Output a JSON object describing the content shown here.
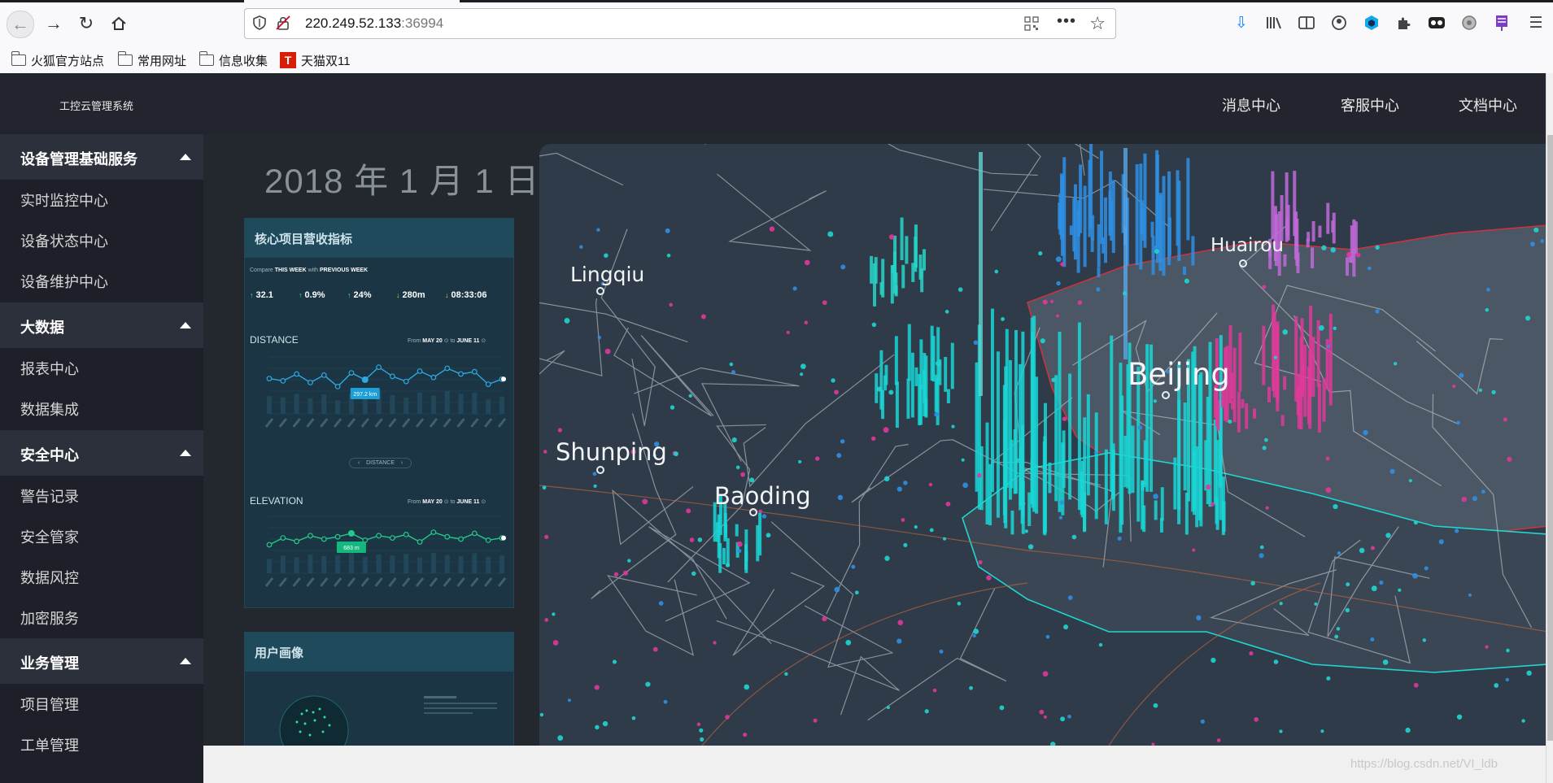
{
  "browser": {
    "url_host": "220.249.52.133",
    "url_port": ":36994",
    "bookmarks": [
      {
        "label": "火狐官方站点",
        "icon": "folder-icon"
      },
      {
        "label": "常用网址",
        "icon": "folder-icon"
      },
      {
        "label": "信息收集",
        "icon": "folder-icon"
      },
      {
        "label": "天猫双11",
        "icon": "tmall-icon",
        "icon_text": "T"
      }
    ]
  },
  "header": {
    "app_title": "工控云管理系统",
    "links": [
      "消息中心",
      "客服中心",
      "文档中心"
    ]
  },
  "sidebar": {
    "groups": [
      {
        "label": "设备管理基础服务",
        "items": [
          "实时监控中心",
          "设备状态中心",
          "设备维护中心"
        ]
      },
      {
        "label": "大数据",
        "items": [
          "报表中心",
          "数据集成"
        ]
      },
      {
        "label": "安全中心",
        "items": [
          "警告记录",
          "安全管家",
          "数据风控",
          "加密服务"
        ]
      },
      {
        "label": "业务管理",
        "items": [
          "项目管理",
          "工单管理"
        ]
      }
    ]
  },
  "dashboard": {
    "date": "2018 年 1 月 1 日",
    "panel1": {
      "title": "核心项目营收指标",
      "compare": "Compare",
      "this_week": "THIS WEEK",
      "with": "with",
      "previous_week": "PREVIOUS WEEK",
      "metrics": [
        {
          "value": "32.1",
          "trend": "up"
        },
        {
          "value": "0.9%",
          "trend": "up"
        },
        {
          "value": "24%",
          "trend": "up"
        },
        {
          "value": "280m",
          "trend": "down"
        },
        {
          "value": "08:33:06",
          "trend": "down"
        }
      ],
      "distance": {
        "title": "DISTANCE",
        "from": "From",
        "start": "MAY 20",
        "to": "to",
        "end": "JUNE 11",
        "tooltip": "297.2 km",
        "values": [
          62,
          58,
          70,
          55,
          68,
          48,
          72,
          60,
          82,
          66,
          57,
          75,
          64,
          80,
          70,
          74,
          52,
          61
        ],
        "highlight_index": 7
      },
      "elevation": {
        "title": "ELEVATION",
        "from": "From",
        "start": "MAY 20",
        "to": "to",
        "end": "JUNE 11",
        "tooltip": "683 m",
        "values": [
          50,
          62,
          56,
          66,
          60,
          64,
          70,
          58,
          66,
          62,
          68,
          55,
          72,
          64,
          60,
          70,
          58,
          62
        ],
        "highlight_index": 6
      }
    },
    "panel2": {
      "title": "用户画像"
    },
    "map": {
      "cities": [
        {
          "name": "Lingqiu"
        },
        {
          "name": "Huairou"
        },
        {
          "name": "Beijing"
        },
        {
          "name": "Shunping"
        },
        {
          "name": "Baoding"
        }
      ]
    }
  },
  "watermark": "https://blog.csdn.net/VI_ldb",
  "colors": {
    "header_bg": "#22252d",
    "sidebar_bg": "#1d2029",
    "group_bg": "#2c303b",
    "panel_bg": "#1b3544",
    "accent_teal": "#1de1c7",
    "accent_blue": "#1f8fe3",
    "accent_magenta": "#e0399a"
  }
}
